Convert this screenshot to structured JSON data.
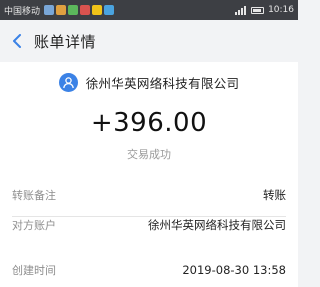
{
  "status_bar": {
    "carrier": "中国移动",
    "time": "10:16"
  },
  "nav": {
    "title": "账单详情"
  },
  "payee": {
    "name": "徐州华英网络科技有限公司"
  },
  "transaction": {
    "amount": "+396.00",
    "status": "交易成功"
  },
  "details": [
    {
      "label": "转账备注",
      "value": "转账"
    },
    {
      "label": "对方账户",
      "value": "徐州华英网络科技有限公司"
    },
    {
      "label": "创建时间",
      "value": "2019-08-30 13:58"
    }
  ],
  "colors": {
    "accent": "#3b82e6",
    "status_bar_bg": "#3d3f44"
  },
  "icons": {
    "back": "chevron-left-icon",
    "payee": "user-avatar-icon"
  }
}
